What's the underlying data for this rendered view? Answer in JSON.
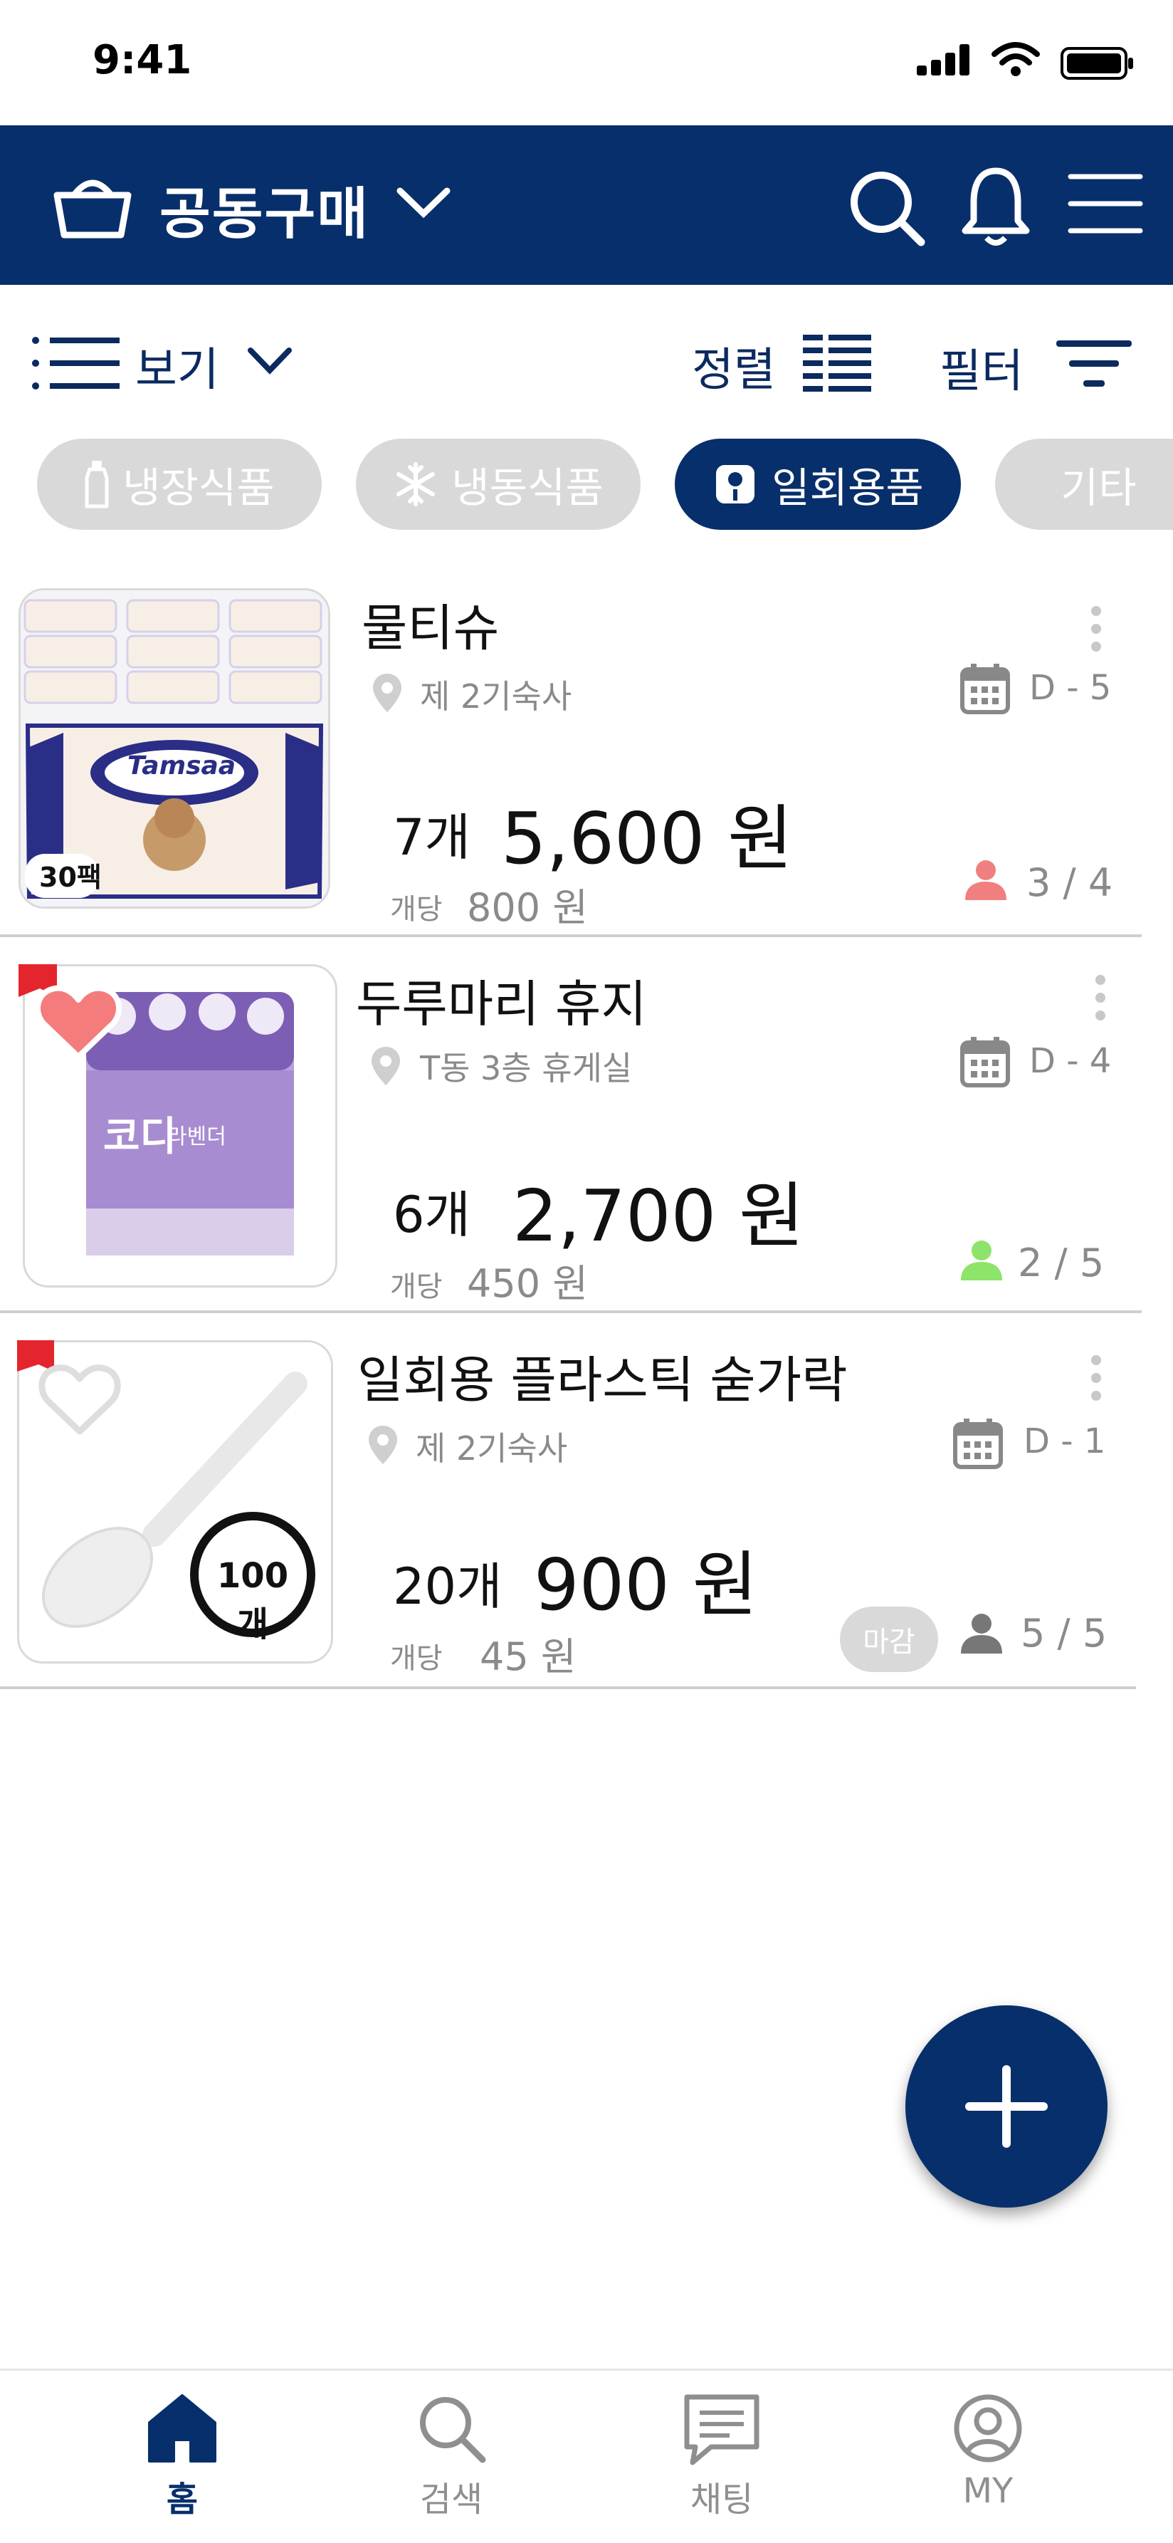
{
  "status_bar": {
    "time": "9:41"
  },
  "header": {
    "title": "공동구매"
  },
  "toolbar": {
    "view_label": "보기",
    "sort_label": "정렬",
    "filter_label": "필터"
  },
  "categories": [
    {
      "label": "냉장식품",
      "icon": "bottle-icon",
      "active": false
    },
    {
      "label": "냉동식품",
      "icon": "snowflake-icon",
      "active": false
    },
    {
      "label": "일회용품",
      "icon": "tissue-roll-icon",
      "active": true
    },
    {
      "label": "기타",
      "icon": "",
      "active": false
    }
  ],
  "products": [
    {
      "title": "물티슈",
      "location": "제 2기숙사",
      "dday": "D - 5",
      "quantity": "7개",
      "price": "5,600 원",
      "unit_label": "개당",
      "unit_price": "800 원",
      "participants": "3 / 4",
      "participant_color": "#f08080",
      "image_badge": "30팩",
      "image_brand": "Tamsaa"
    },
    {
      "title": "두루마리 휴지",
      "location": "T동 3층 휴게실",
      "dday": "D - 4",
      "quantity": "6개",
      "price": "2,700 원",
      "unit_label": "개당",
      "unit_price": "450 원",
      "participants": "2 / 5",
      "participant_color": "#8ee36a",
      "image_brand": "코디",
      "image_sub": "라벤더"
    },
    {
      "title": "일회용 플라스틱 숟가락",
      "location": "제 2기숙사",
      "dday": "D - 1",
      "quantity": "20개",
      "price": "900 원",
      "unit_label": "개당",
      "unit_price": "45 원",
      "participants": "5 / 5",
      "participant_color": "#777777",
      "closed_label": "마감",
      "image_badge": "100개"
    }
  ],
  "bottom_nav": [
    {
      "label": "홈",
      "icon": "home-icon",
      "active": true
    },
    {
      "label": "검색",
      "icon": "search-icon",
      "active": false
    },
    {
      "label": "채팅",
      "icon": "chat-icon",
      "active": false
    },
    {
      "label": "MY",
      "icon": "profile-icon",
      "active": false
    }
  ],
  "colors": {
    "primary": "#072f6b",
    "chip_inactive": "#d9d9d9",
    "muted_text": "#8a8a8a"
  }
}
